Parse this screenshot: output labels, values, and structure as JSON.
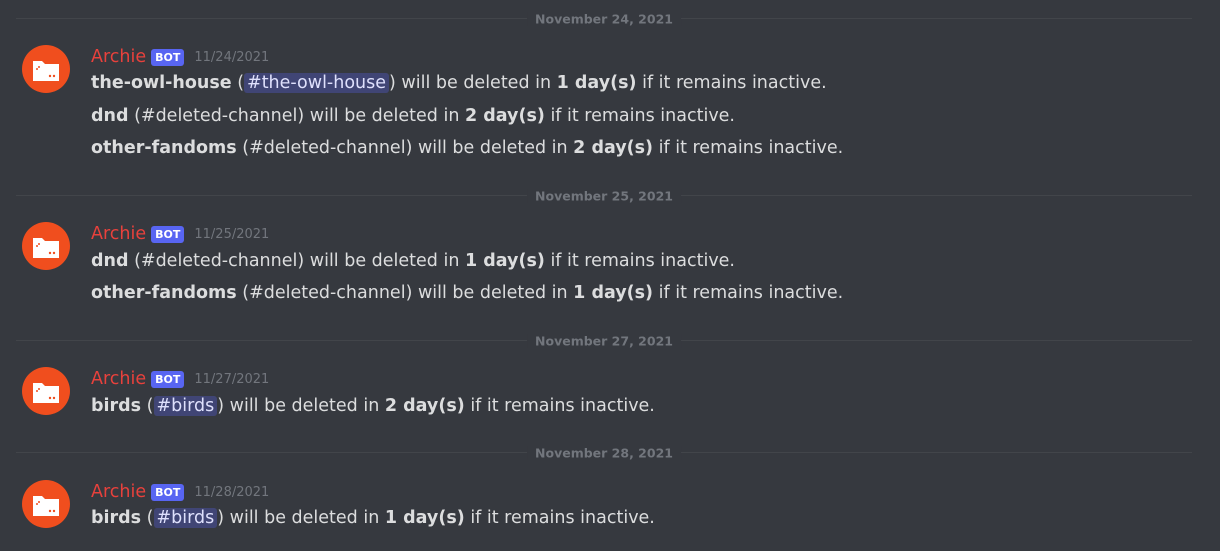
{
  "dividers": [
    {
      "label": "November 24, 2021"
    },
    {
      "label": "November 25, 2021"
    },
    {
      "label": "November 27, 2021"
    },
    {
      "label": "November 28, 2021"
    }
  ],
  "messages": [
    {
      "author": "Archie",
      "badge": "BOT",
      "timestamp": "11/24/2021",
      "lines": [
        {
          "name": "the-owl-house",
          "open": " (",
          "channel": "#the-owl-house",
          "close": ")",
          "mid": " will be deleted in ",
          "days": "1 day(s)",
          "end": " if it remains inactive."
        },
        {
          "name": "dnd",
          "open": " (",
          "channel": "#deleted-channel",
          "close": ")",
          "mid": " will be deleted in ",
          "days": "2 day(s)",
          "end": " if it remains inactive."
        },
        {
          "name": "other-fandoms",
          "open": " (",
          "channel": "#deleted-channel",
          "close": ")",
          "mid": " will be deleted in ",
          "days": "2 day(s)",
          "end": " if it remains inactive."
        }
      ]
    },
    {
      "author": "Archie",
      "badge": "BOT",
      "timestamp": "11/25/2021",
      "lines": [
        {
          "name": "dnd",
          "open": " (",
          "channel": "#deleted-channel",
          "close": ")",
          "mid": " will be deleted in ",
          "days": "1 day(s)",
          "end": " if it remains inactive."
        },
        {
          "name": "other-fandoms",
          "open": " (",
          "channel": "#deleted-channel",
          "close": ")",
          "mid": " will be deleted in ",
          "days": "1 day(s)",
          "end": " if it remains inactive."
        }
      ]
    },
    {
      "author": "Archie",
      "badge": "BOT",
      "timestamp": "11/27/2021",
      "lines": [
        {
          "name": "birds",
          "open": " (",
          "channel": "#birds",
          "close": ")",
          "mid": " will be deleted in ",
          "days": "2 day(s)",
          "end": " if it remains inactive."
        }
      ]
    },
    {
      "author": "Archie",
      "badge": "BOT",
      "timestamp": "11/28/2021",
      "lines": [
        {
          "name": "birds",
          "open": " (",
          "channel": "#birds",
          "close": ")",
          "mid": " will be deleted in ",
          "days": "1 day(s)",
          "end": " if it remains inactive."
        }
      ]
    }
  ],
  "colors": {
    "background": "#36393f",
    "author": "#e8413c",
    "bot_badge": "#5865f2",
    "avatar": "#f04e1e",
    "mention_bg": "rgba(88,101,242,0.3)"
  },
  "avatar_icon": "folder-icon"
}
